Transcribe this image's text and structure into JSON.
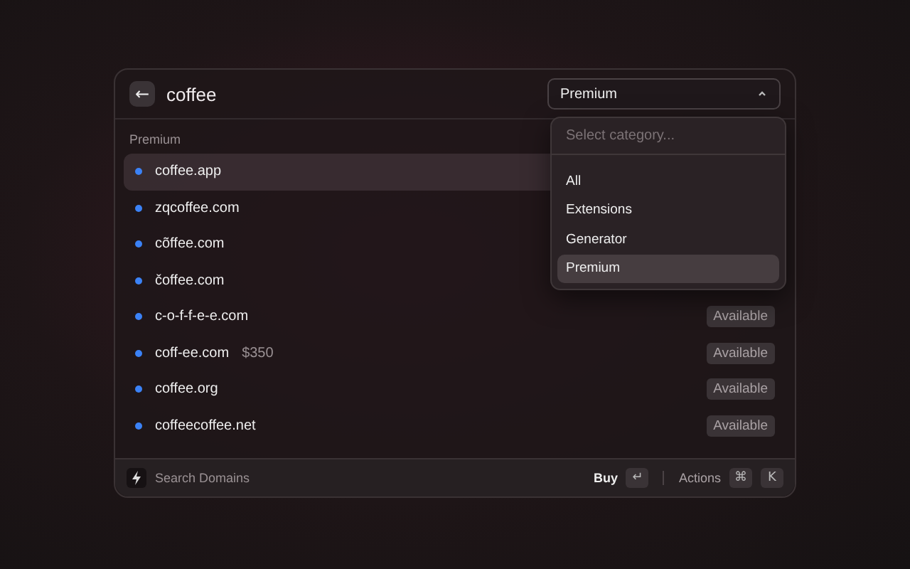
{
  "header": {
    "back_label": "←",
    "query": "coffee",
    "category": {
      "value": "Premium",
      "expanded": true
    }
  },
  "dropdown": {
    "placeholder": "Select category...",
    "options": [
      {
        "label": "All",
        "selected": false
      },
      {
        "label": "Extensions",
        "selected": false
      },
      {
        "label": "Generator",
        "selected": false
      },
      {
        "label": "Premium",
        "selected": true
      }
    ]
  },
  "section": "Premium",
  "rows": [
    {
      "domain": "coffee.app",
      "selected": true,
      "color": "#3b82f6"
    },
    {
      "domain": "zqcoffee.com",
      "selected": false,
      "color": "#3b82f6"
    },
    {
      "domain": "cõffee.com",
      "selected": false,
      "color": "#3b82f6"
    },
    {
      "domain": "čoffee.com",
      "selected": false,
      "color": "#3b82f6"
    },
    {
      "domain": "c-o-f-f-e-e.com",
      "selected": false,
      "color": "#3b82f6",
      "status": "Available"
    },
    {
      "domain": "coff-ee.com",
      "price": "$350",
      "selected": false,
      "color": "#3b82f6",
      "status": "Available"
    },
    {
      "domain": "coffee.org",
      "selected": false,
      "color": "#3b82f6",
      "status": "Available"
    },
    {
      "domain": "coffeecoffee.net",
      "selected": false,
      "color": "#3b82f6",
      "status": "Available"
    }
  ],
  "footer": {
    "title": "Search Domains",
    "primary_action": "Buy",
    "primary_key": "↵",
    "secondary_action": "Actions",
    "secondary_keys": [
      "⌘",
      "K"
    ]
  }
}
